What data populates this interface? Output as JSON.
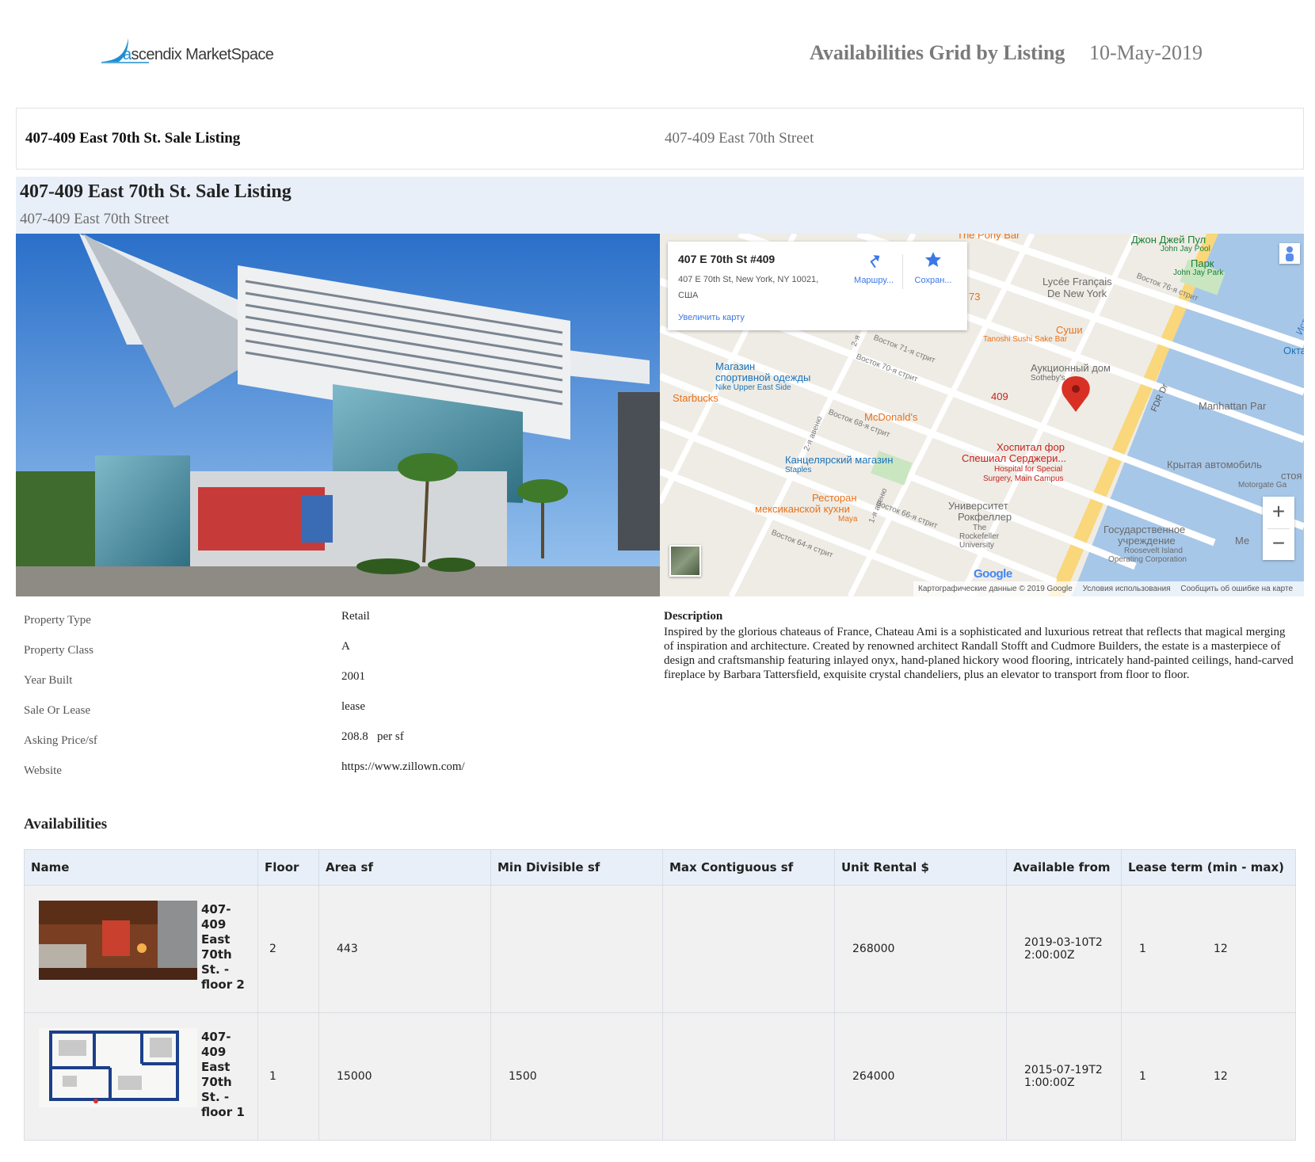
{
  "header": {
    "logo_prefix": "a",
    "logo_text": "scendix MarketSpace",
    "report_title": "Availabilities Grid by Listing",
    "report_date": "10-May-2019"
  },
  "listing_bar": {
    "name": "407-409 East 70th St. Sale Listing",
    "address": "407-409 East 70th Street"
  },
  "hero": {
    "title": "407-409 East 70th St. Sale Listing",
    "subtitle": "407-409 East 70th Street"
  },
  "map": {
    "card": {
      "title": "407 E 70th St #409",
      "address_line1": "407 E 70th St, New York, NY 10021,",
      "address_line2": "США",
      "directions_label": "Маршру...",
      "save_label": "Сохран...",
      "zoom_link": "Увеличить карту"
    },
    "pin_label": "409",
    "pois": {
      "pony_bar": "The Pony Bar",
      "john_jay_pool_ru": "Джон Джей Пул",
      "john_jay_pool_en": "John Jay Pool",
      "park_ru": "Парк",
      "park_en": "John Jay Park",
      "lycee_1": "Lycée Français",
      "lycee_2": "De New York",
      "sushi_ru": "Суши",
      "sushi_en": "Tanoshi Sushi Sake Bar",
      "sports_1": "Магазин",
      "sports_2": "спортивной одежды",
      "sports_en": "Nike Upper East Side",
      "auction_ru": "Аукционный дом",
      "auction_en": "Sotheby's",
      "starbucks": "Starbucks",
      "mcdonalds": "McDonald's",
      "hospital_1": "Хоспитал фор",
      "hospital_2": "Спешиал Серджери...",
      "hospital_en_1": "Hospital for Special",
      "hospital_en_2": "Surgery, Main Campus",
      "stationery_ru": "Канцелярский магазин",
      "stationery_en": "Staples",
      "restaurant_1": "Ресторан",
      "restaurant_2": "мексиканской кухни",
      "restaurant_en": "Maya",
      "university_1": "Университет",
      "university_2": "Рокфеллер",
      "university_en_1": "The",
      "university_en_2": "Rockefeller",
      "university_en_3": "University",
      "gov_1": "Государственное",
      "gov_2": "учреждение",
      "gov_en_1": "Roosevelt Island",
      "gov_en_2": "Operating Corporation",
      "manhattan_park": "Manhattan Par",
      "covered_parking_1": "Крытая автомобиль",
      "covered_parking_2": "стоя",
      "covered_parking_en": "Motorgate Ga",
      "east_river": "Ист-Р",
      "okta": "Окта",
      "fdr": "FDR Dr",
      "num_73": "73",
      "me": "Ме"
    },
    "streets": {
      "e76": "Восток 76-я стрит",
      "e71": "Восток 71-я стрит",
      "e70": "Восток 70-я стрит",
      "e68": "Восток 68-я стрит",
      "e66": "Восток 66-я стрит",
      "e64": "Восток 64-я стрит",
      "ave2": "2-я авеню",
      "ave1": "1-я авеню",
      "ave2b": "2-я"
    },
    "zoom_in": "+",
    "zoom_out": "−",
    "google": "Google",
    "attribution": {
      "data": "Картографические данные © 2019 Google",
      "terms": "Условия использования",
      "report": "Сообщить об ошибке на карте"
    }
  },
  "properties": [
    {
      "label": "Property Type",
      "value": "Retail"
    },
    {
      "label": "Property Class",
      "value": "A"
    },
    {
      "label": "Year Built",
      "value": "2001"
    },
    {
      "label": "Sale Or Lease",
      "value": "lease"
    },
    {
      "label": "Asking Price/sf",
      "value": "208.8   per sf"
    },
    {
      "label": "Website",
      "value": "https://www.zillown.com/"
    }
  ],
  "description": {
    "title": "Description",
    "body": "Inspired by the glorious chateaus of France, Chateau Ami is a sophisticated and luxurious retreat that reflects that magical merging of inspiration and architecture. Created by renowned architect Randall Stofft and Cudmore Builders, the estate is a masterpiece of design and craftsmanship featuring inlayed onyx, hand-planed hickory wood flooring, intricately hand-painted ceilings, hand-carved fireplace by Barbara Tattersfield, exquisite crystal chandeliers, plus an elevator to transport from floor to floor."
  },
  "availabilities": {
    "title": "Availabilities",
    "columns": [
      "Name",
      "Floor",
      "Area sf",
      "Min Divisible sf",
      "Max Contiguous sf",
      "Unit Rental $",
      "Available from",
      "Lease term (min - max)"
    ],
    "rows": [
      {
        "name": "407-409 East 70th St. - floor 2",
        "floor": "2",
        "area": "443",
        "min_div": "",
        "max_contig": "",
        "rental": "268000",
        "available": "2019-03-10T22:00:00Z",
        "lease_min": "1",
        "lease_max": "12"
      },
      {
        "name": "407-409 East 70th St. - floor 1",
        "floor": "1",
        "area": "15000",
        "min_div": "1500",
        "max_contig": "",
        "rental": "264000",
        "available": "2015-07-19T21:00:00Z",
        "lease_min": "1",
        "lease_max": "12"
      }
    ]
  },
  "colors": {
    "accent_blue": "#1f8fd0",
    "band_bg": "#e8eff8",
    "row_bg": "#f1f1f1",
    "map_pin": "#d93025"
  }
}
